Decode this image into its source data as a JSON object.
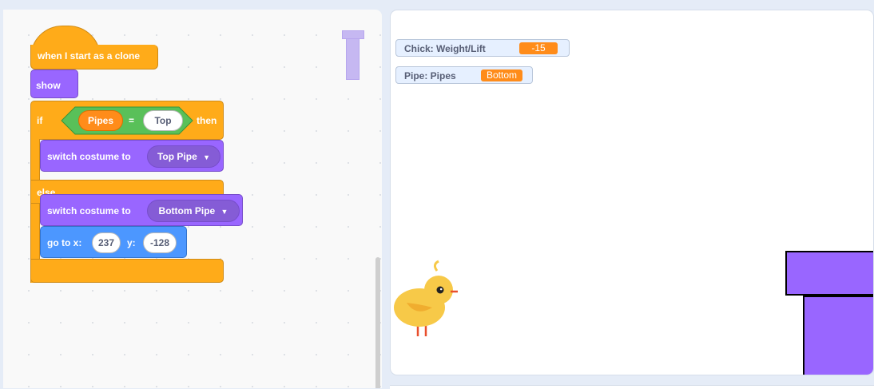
{
  "code": {
    "hat_label": "when I start as a clone",
    "show_label": "show",
    "if_label": "if",
    "then_label": "then",
    "else_label": "else",
    "condition": {
      "left_reporter": "Pipes",
      "operator": "=",
      "right_value": "Top"
    },
    "switch_label": "switch costume to",
    "costume_top": "Top Pipe",
    "costume_bottom": "Bottom Pipe",
    "goto": {
      "label": "go to x:",
      "x_value": "237",
      "y_label": "y:",
      "y_value": "-128"
    },
    "colors": {
      "events": "#ffab19",
      "looks": "#9966ff",
      "motion": "#4c97ff",
      "operators": "#59c059",
      "variables": "#ff8c1a"
    }
  },
  "stage": {
    "monitors": [
      {
        "name": "Chick: Weight/Lift",
        "value": "-15"
      },
      {
        "name": "Pipe: Pipes",
        "value": "Bottom"
      }
    ],
    "sprites": {
      "chick": "chick-sprite",
      "pipe": "pipe-sprite"
    }
  }
}
